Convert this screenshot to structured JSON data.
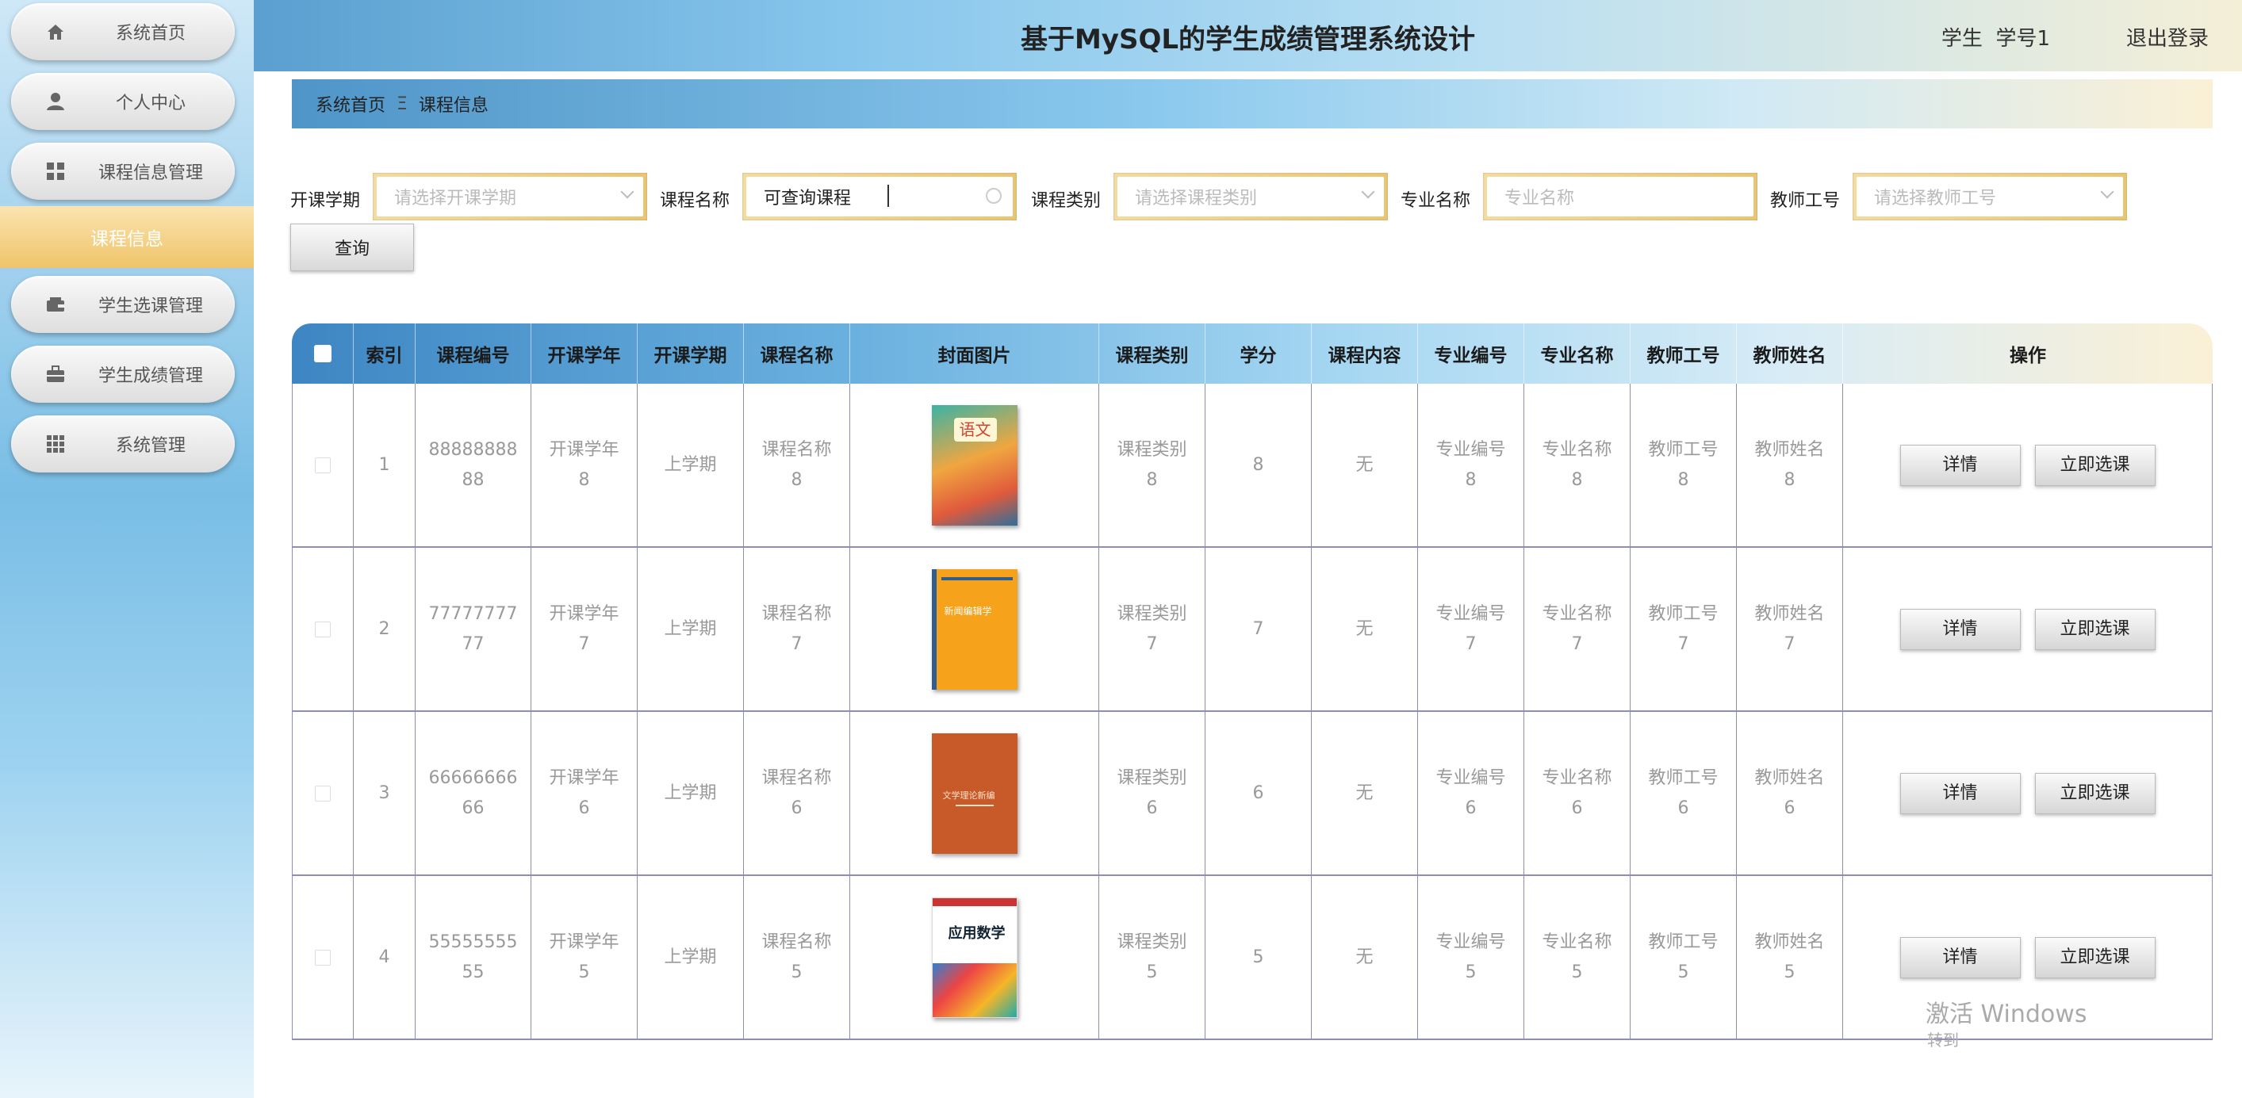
{
  "header": {
    "title": "基于MySQL的学生成绩管理系统设计",
    "user": "学生  学号1",
    "logout": "退出登录"
  },
  "sidebar": {
    "items": [
      {
        "label": "系统首页",
        "icon": "home-icon"
      },
      {
        "label": "个人中心",
        "icon": "user-icon"
      },
      {
        "label": "课程信息管理",
        "icon": "grid-icon"
      },
      {
        "label": "学生选课管理",
        "icon": "wallet-icon"
      },
      {
        "label": "学生成绩管理",
        "icon": "briefcase-icon"
      },
      {
        "label": "系统管理",
        "icon": "apps-icon"
      }
    ],
    "active_sub": "课程信息"
  },
  "breadcrumb": {
    "home": "系统首页",
    "separator": "Ξ",
    "current": "课程信息"
  },
  "filters": {
    "semester": {
      "label": "开课学期",
      "placeholder": "请选择开课学期"
    },
    "course_name": {
      "label": "课程名称",
      "value": "可查询课程"
    },
    "course_type": {
      "label": "课程类别",
      "placeholder": "请选择课程类别"
    },
    "major_name": {
      "label": "专业名称",
      "placeholder": "专业名称"
    },
    "teacher_no": {
      "label": "教师工号",
      "placeholder": "请选择教师工号"
    },
    "search_button": "查询"
  },
  "table": {
    "columns": [
      "索引",
      "课程编号",
      "开课学年",
      "开课学期",
      "课程名称",
      "封面图片",
      "课程类别",
      "学分",
      "课程内容",
      "专业编号",
      "专业名称",
      "教师工号",
      "教师姓名",
      "操作"
    ],
    "rows": [
      {
        "index": "1",
        "code1": "88888888",
        "code2": "88",
        "year1": "开课学年",
        "year2": "8",
        "term": "上学期",
        "name1": "课程名称",
        "name2": "8",
        "type1": "课程类别",
        "type2": "8",
        "credit": "8",
        "content": "无",
        "mno1": "专业编号",
        "mno2": "8",
        "mname1": "专业名称",
        "mname2": "8",
        "tno1": "教师工号",
        "tno2": "8",
        "tname1": "教师姓名",
        "tname2": "8",
        "cover": "语文",
        "detail": "详情",
        "select": "立即选课"
      },
      {
        "index": "2",
        "code1": "77777777",
        "code2": "77",
        "year1": "开课学年",
        "year2": "7",
        "term": "上学期",
        "name1": "课程名称",
        "name2": "7",
        "type1": "课程类别",
        "type2": "7",
        "credit": "7",
        "content": "无",
        "mno1": "专业编号",
        "mno2": "7",
        "mname1": "专业名称",
        "mname2": "7",
        "tno1": "教师工号",
        "tno2": "7",
        "tname1": "教师姓名",
        "tname2": "7",
        "cover": "新闻编辑学",
        "detail": "详情",
        "select": "立即选课"
      },
      {
        "index": "3",
        "code1": "66666666",
        "code2": "66",
        "year1": "开课学年",
        "year2": "6",
        "term": "上学期",
        "name1": "课程名称",
        "name2": "6",
        "type1": "课程类别",
        "type2": "6",
        "credit": "6",
        "content": "无",
        "mno1": "专业编号",
        "mno2": "6",
        "mname1": "专业名称",
        "mname2": "6",
        "tno1": "教师工号",
        "tno2": "6",
        "tname1": "教师姓名",
        "tname2": "6",
        "cover": "文学理论新编",
        "detail": "详情",
        "select": "立即选课"
      },
      {
        "index": "4",
        "code1": "55555555",
        "code2": "55",
        "year1": "开课学年",
        "year2": "5",
        "term": "上学期",
        "name1": "课程名称",
        "name2": "5",
        "type1": "课程类别",
        "type2": "5",
        "credit": "5",
        "content": "无",
        "mno1": "专业编号",
        "mno2": "5",
        "mname1": "专业名称",
        "mname2": "5",
        "tno1": "教师工号",
        "tno2": "5",
        "tname1": "教师姓名",
        "tname2": "5",
        "cover": "应用数学",
        "detail": "详情",
        "select": "立即选课"
      }
    ]
  },
  "watermark": {
    "line1": "激活 Windows",
    "line2": "转到"
  },
  "colors": {
    "accent_gold": "#e9c675",
    "sidebar_blue": "#79bde5",
    "header_blue": "#5a9fd0",
    "grid_line": "#8d8db5"
  }
}
